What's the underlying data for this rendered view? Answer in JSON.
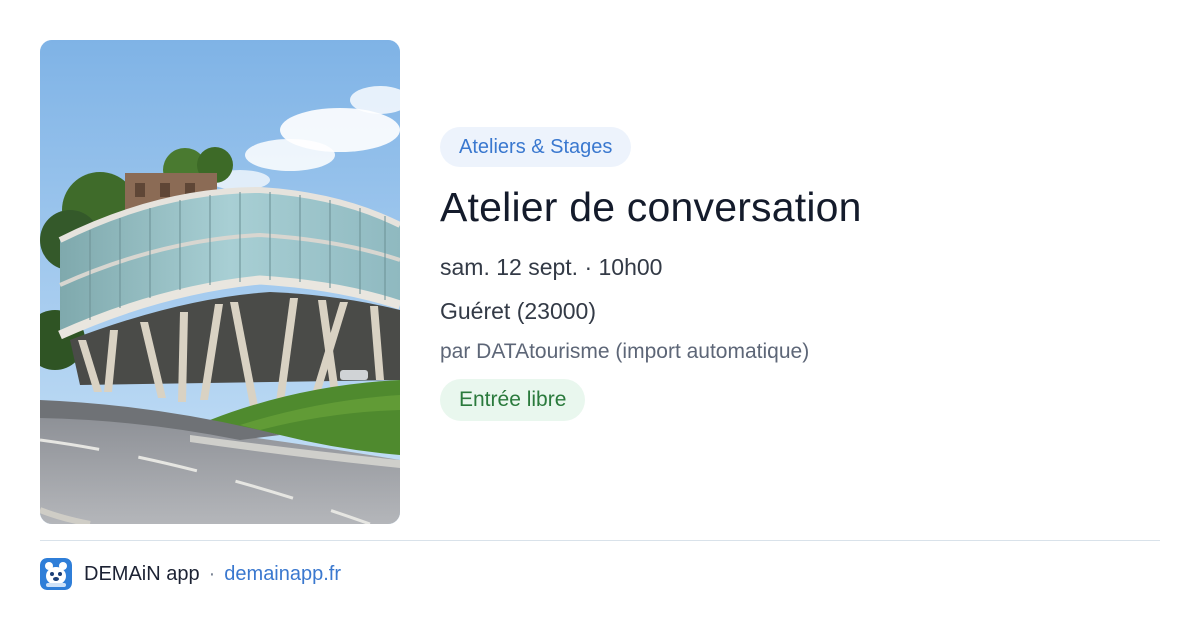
{
  "event": {
    "category": "Ateliers & Stages",
    "title": "Atelier de conversation",
    "datetime": "sam. 12 sept. · 10h00",
    "location": "Guéret (23000)",
    "source": "par DATAtourisme (import automatique)",
    "price": "Entrée libre",
    "image_icon": "building-photo"
  },
  "footer": {
    "app_name": "DEMAiN app",
    "separator": "·",
    "url": "demainapp.fr",
    "logo_icon": "app-logo-icon"
  },
  "colors": {
    "accent": "#3a78cf",
    "category_bg": "#edf3fc",
    "price_text": "#2a7a3c",
    "price_bg": "#e9f7ee",
    "divider": "#d9e2ea"
  }
}
